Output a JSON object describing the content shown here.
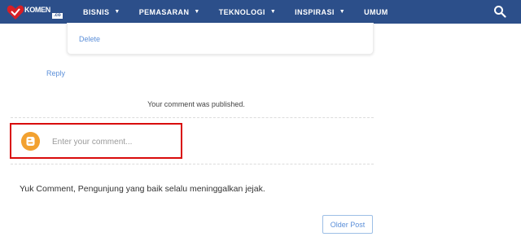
{
  "header": {
    "logo": {
      "wordmark": "KOMEN",
      "tld": ".co"
    },
    "menu": [
      {
        "label": "BISNIS",
        "has_dropdown": true
      },
      {
        "label": "PEMASARAN",
        "has_dropdown": true
      },
      {
        "label": "TEKNOLOGI",
        "has_dropdown": true
      },
      {
        "label": "INSPIRASI",
        "has_dropdown": true
      },
      {
        "label": "UMUM",
        "has_dropdown": false
      }
    ],
    "chevron_glyph": "▼",
    "search_icon": "search-icon",
    "background_color": "#2c4f8a"
  },
  "comment": {
    "delete_label": "Delete",
    "reply_label": "Reply",
    "published_message": "Your comment was published."
  },
  "comment_form": {
    "placeholder": "Enter your comment...",
    "value": "",
    "avatar_icon": "blogger-icon",
    "highlight_color": "#d90c0c",
    "avatar_color": "#f2a130"
  },
  "note": "Yuk Comment, Pengunjung yang baik selalu meninggalkan jejak.",
  "pagination": {
    "older_label": "Older Post"
  },
  "link_color": "#5b8fd9"
}
